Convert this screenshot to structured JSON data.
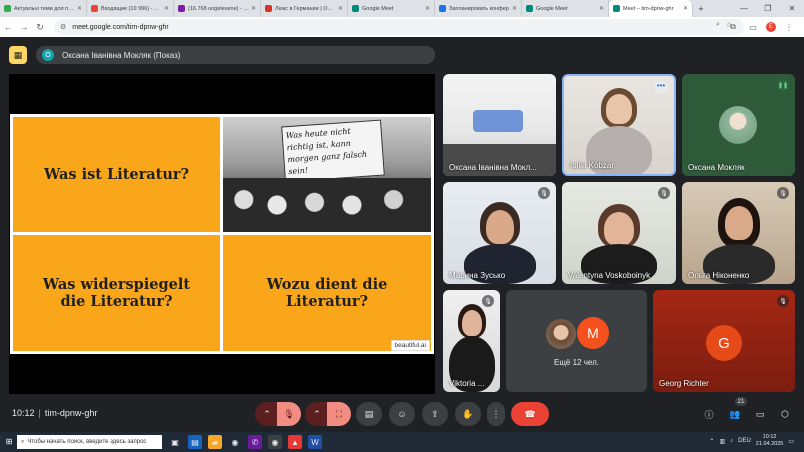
{
  "browser": {
    "tabs": [
      {
        "title": "Актуальні теми для публ",
        "color": "#34a853"
      },
      {
        "title": "Входящие (10 996) - язуз",
        "color": "#ea4335"
      },
      {
        "title": "(16.768 ungelesene) - von",
        "color": "#7b1fa2"
      },
      {
        "title": "Люкс в Германии | Online",
        "color": "#d93025"
      },
      {
        "title": "Google Meet",
        "color": "#00897b"
      },
      {
        "title": "Запланировать конфер",
        "color": "#1a73e8"
      },
      {
        "title": "Google Meet",
        "color": "#00897b"
      },
      {
        "title": "Meet – tim-dpnw-ghr",
        "color": "#00897b"
      }
    ],
    "url": "meet.google.com/tim-dpnw-ghr",
    "profile_letter": "E"
  },
  "meet": {
    "presenter_initial": "О",
    "presenter_label": "Оксана Іванівна Мокляк (Показ)",
    "meeting_code": "tim-dpnw-ghr",
    "time": "10:12",
    "people_count": "21",
    "colors": {
      "accent": "#f9a61a",
      "hangup": "#ea4335",
      "muted": "#f28b82"
    }
  },
  "slide": {
    "q1": "Was ist Literatur?",
    "q2": "Was widerspiegelt die Literatur?",
    "q3": "Wozu dient die Literatur?",
    "sign": "Was heute nicht richtig ist, kann morgen ganz falsch sein!",
    "brand": "beautiful.ai"
  },
  "participants": [
    {
      "name": "Оксана Іванівна Мокл..."
    },
    {
      "name": "Iuliia Kobzar"
    },
    {
      "name": "Оксана Мокляк"
    },
    {
      "name": "Марина Зусько"
    },
    {
      "name": "Valentyna Voskoboinyk"
    },
    {
      "name": "Ольга Ніконенко"
    },
    {
      "name": "Viktoria ..."
    },
    {
      "name": "Ещё 12 чел.",
      "avatar_letter": "M"
    },
    {
      "name": "Georg Richter",
      "avatar_letter": "G"
    }
  ],
  "taskbar": {
    "search_placeholder": "Чтобы начать поиск, введите здесь запрос",
    "lang": "DEU",
    "clock_time": "10:12",
    "clock_date": "21.04.2025"
  }
}
